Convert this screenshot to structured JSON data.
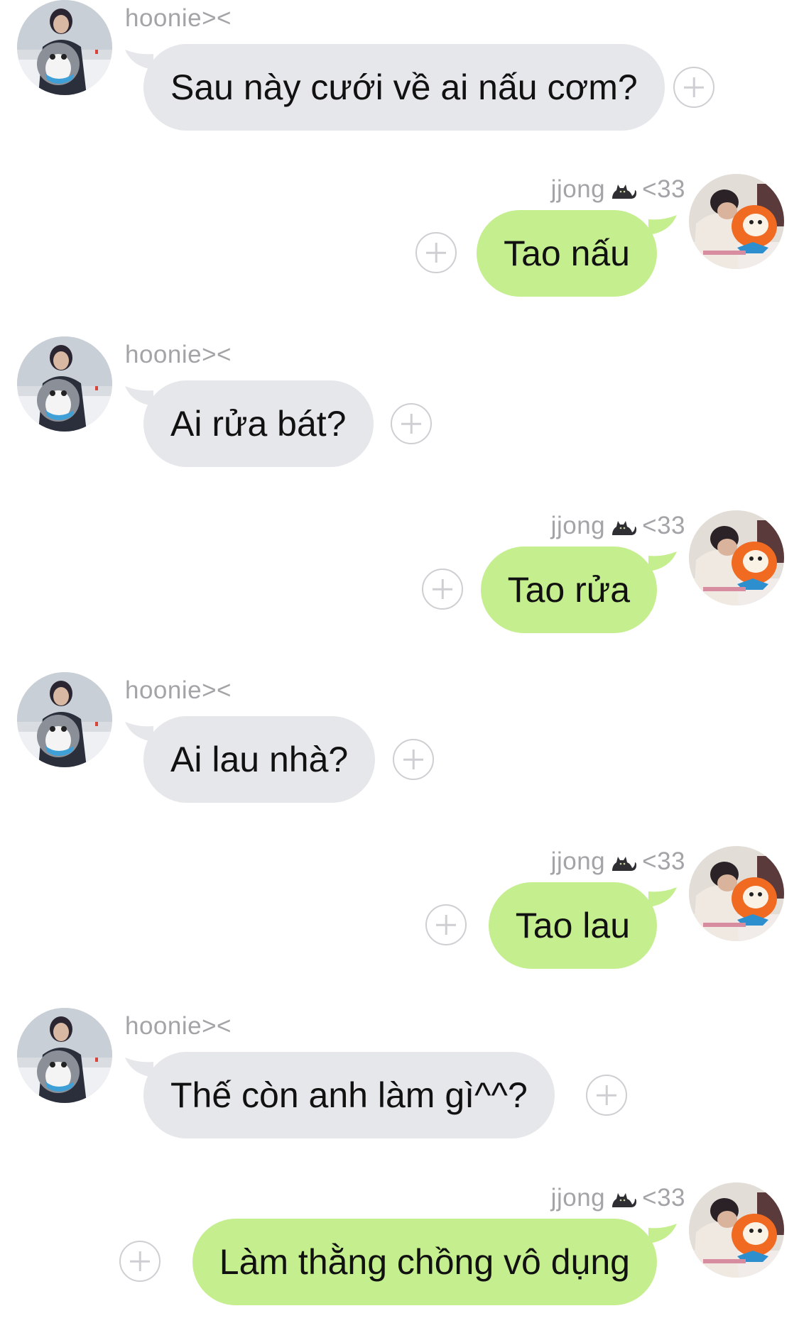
{
  "chat": {
    "messages": [
      {
        "side": "left",
        "sender": "hoonie><",
        "text": "Sau này cưới về ai nấu cơm?"
      },
      {
        "side": "right",
        "sender_name": "jjong",
        "sender_suffix": "<33",
        "sender_icon": "cat-icon",
        "text": "Tao nấu"
      },
      {
        "side": "left",
        "sender": "hoonie><",
        "text": "Ai rửa bát?"
      },
      {
        "side": "right",
        "sender_name": "jjong",
        "sender_suffix": "<33",
        "sender_icon": "cat-icon",
        "text": "Tao rửa"
      },
      {
        "side": "left",
        "sender": "hoonie><",
        "text": "Ai lau nhà?"
      },
      {
        "side": "right",
        "sender_name": "jjong",
        "sender_suffix": "<33",
        "sender_icon": "cat-icon",
        "text": "Tao lau"
      },
      {
        "side": "left",
        "sender": "hoonie><",
        "text": "Thế còn anh làm gì^^?"
      },
      {
        "side": "right",
        "sender_name": "jjong",
        "sender_suffix": "<33",
        "sender_icon": "cat-icon",
        "text": "Làm thằng chồng vô dụng"
      }
    ]
  },
  "colors": {
    "incoming_bubble": "#e6e7eb",
    "outgoing_bubble": "#c5ee8f",
    "sender_text": "#a4a4a8",
    "message_text": "#111111",
    "add_button": "#cfcfd3"
  }
}
